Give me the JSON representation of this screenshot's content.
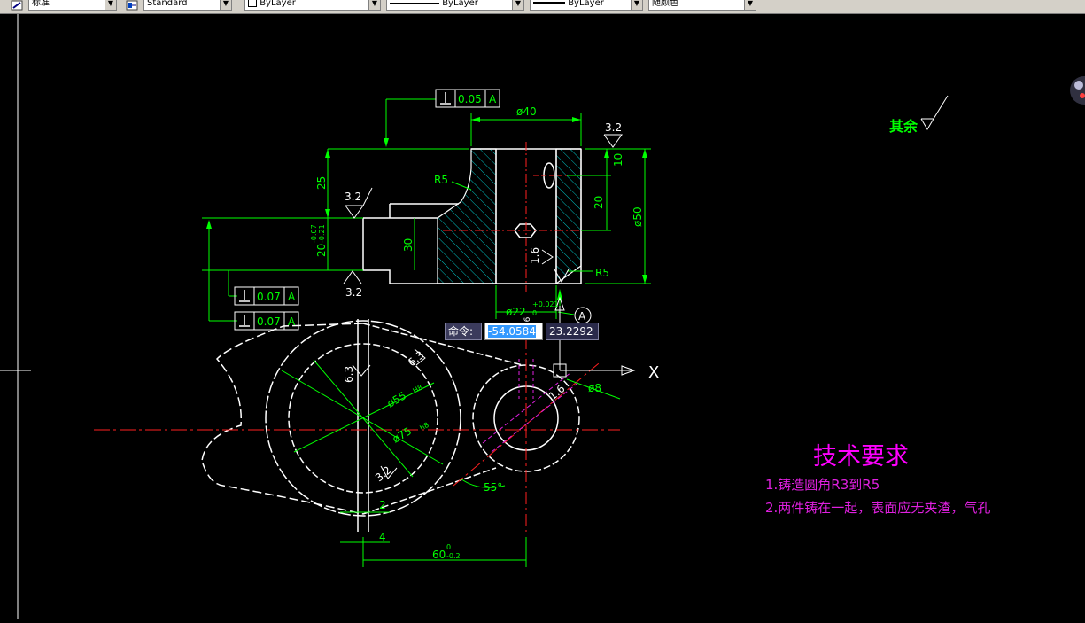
{
  "toolbar": {
    "text_style": "标准",
    "dim_style": "Standard",
    "layer": "ByLayer",
    "linetype": "ByLayer",
    "lineweight": "ByLayer",
    "color": "随颜色"
  },
  "dynamic_input": {
    "prompt": "命令:",
    "x_value": "-54.0584",
    "y_value": "23.2292"
  },
  "ucs": {
    "x_label": "X"
  },
  "drawing": {
    "roughness_rest_label": "其余",
    "tolerance_1": "0.05",
    "tolerance_1_datum": "A",
    "tolerance_2": "0.07",
    "tolerance_2_datum": "A",
    "tolerance_3": "0.07",
    "tolerance_3_datum": "A",
    "dim_phi40": "ø40",
    "dim_phi50": "ø50",
    "dim_25": "25",
    "dim_10": "10",
    "dim_20": "20",
    "dim_30": "30",
    "dim_20_tol": "20",
    "dim_20_tol_sup": "-0.07",
    "dim_20_tol_sub": "-0.21",
    "dim_r5_top": "R5",
    "dim_r5_bottom": "R5",
    "dim_phi22": "ø22",
    "dim_phi22_tol": "+0.021",
    "dim_phi22_tol_sub": "0",
    "datum_a": "A",
    "rough_32_a": "3.2",
    "rough_32_b": "3.2",
    "rough_32_c": "3.2",
    "rough_16": "1.6",
    "rough_63_a": "6.3",
    "rough_63_b": "6.3",
    "rough_32_d": "3.2",
    "rough_16_b": "1.6",
    "rough_16_c": "1.6",
    "dim_phi55": "ø55",
    "dim_phi55_tol": "H8",
    "dim_phi75": "ø75",
    "dim_phi75_tol": "h8",
    "dim_phi8": "ø8",
    "dim_55deg": "55°",
    "dim_2": "2",
    "dim_4": "4",
    "dim_60": "60",
    "dim_60_sup": "0",
    "dim_60_sub": "-0.2"
  },
  "tech_requirements": {
    "title": "技术要求",
    "line1": "1.铸造圆角R3到R5",
    "line2": "2.两件铸在一起，表面应无夹渣，气孔"
  },
  "colors": {
    "green": "#00ff00",
    "white": "#ffffff",
    "cyan": "#00c0c0",
    "red": "#ff2020",
    "magenta": "#ff00ff",
    "purple": "#e020e0"
  }
}
